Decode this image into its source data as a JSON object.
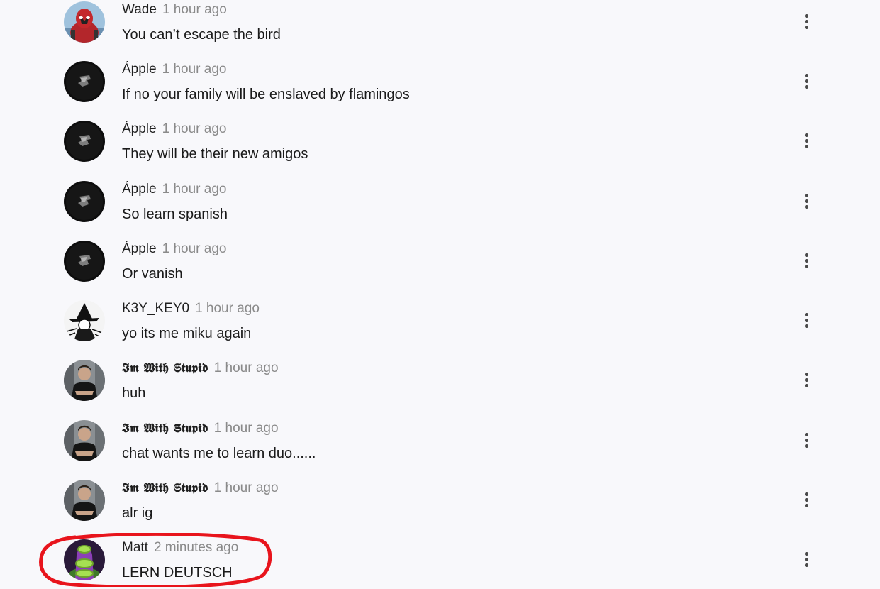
{
  "messages": [
    {
      "author": "Wade",
      "time": "1 hour ago",
      "text": "You can’t escape the bird",
      "avatar": "deadpool-avatar",
      "style": "normal"
    },
    {
      "author": "Ápple",
      "time": "1 hour ago",
      "text": "If no your family will be enslaved by flamingos",
      "avatar": "dark-logo-avatar",
      "style": "normal"
    },
    {
      "author": "Ápple",
      "time": "1 hour ago",
      "text": "They will be their new amigos",
      "avatar": "dark-logo-avatar",
      "style": "normal"
    },
    {
      "author": "Ápple",
      "time": "1 hour ago",
      "text": "So learn spanish",
      "avatar": "dark-logo-avatar",
      "style": "normal"
    },
    {
      "author": "Ápple",
      "time": "1 hour ago",
      "text": "Or vanish",
      "avatar": "dark-logo-avatar",
      "style": "normal"
    },
    {
      "author": "K3Y_KEY0",
      "time": "1 hour ago",
      "text": "yo its me miku again",
      "avatar": "witch-sketch-avatar",
      "style": "normal"
    },
    {
      "author": "𝕴𝖒 𝖂𝖎𝖙𝖍 𝕾𝖙𝖚𝖕𝖎𝖉",
      "time": "1 hour ago",
      "text": "huh",
      "avatar": "man-photo-avatar",
      "style": "gothic"
    },
    {
      "author": "𝕴𝖒 𝖂𝖎𝖙𝖍 𝕾𝖙𝖚𝖕𝖎𝖉",
      "time": "1 hour ago",
      "text": "chat wants me to learn duo......",
      "avatar": "man-photo-avatar",
      "style": "gothic"
    },
    {
      "author": "𝕴𝖒 𝖂𝖎𝖙𝖍 𝕾𝖙𝖚𝖕𝖎𝖉",
      "time": "1 hour ago",
      "text": "alr ig",
      "avatar": "man-photo-avatar",
      "style": "gothic"
    },
    {
      "author": "Matt",
      "time": "2 minutes ago",
      "text": "LERN DEUTSCH",
      "avatar": "purple-tentacle-avatar",
      "style": "normal",
      "highlighted": true
    }
  ],
  "menu_icon": "more-vertical-icon",
  "colors": {
    "background": "#f8f8fb",
    "author": "#1f1f1f",
    "timestamp": "#8a8a8a",
    "text": "#1a1a1a",
    "highlight": "#e8141c"
  }
}
